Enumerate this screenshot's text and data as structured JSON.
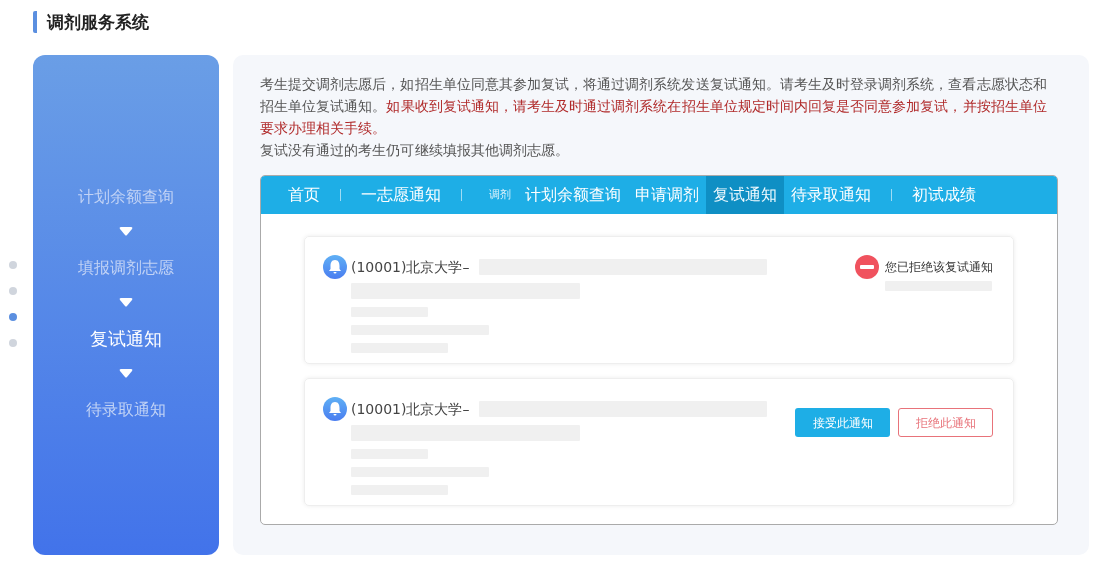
{
  "page_title": "调剂服务系统",
  "page_dots": [
    {
      "selected": false
    },
    {
      "selected": false
    },
    {
      "selected": true
    },
    {
      "selected": false
    }
  ],
  "steps": [
    {
      "label": "计划余额查询",
      "selected": false
    },
    {
      "label": "填报调剂志愿",
      "selected": false
    },
    {
      "label": "复试通知",
      "selected": true
    },
    {
      "label": "待录取通知",
      "selected": false
    }
  ],
  "intro": [
    {
      "segments": [
        {
          "text": "考生提交调剂志愿后，如招生单位同意其参加复试，将通过调剂系统发送复试通知。请考生及时登录调剂系统，查看志愿状态和招生单位复试通知。",
          "emphasis": false
        },
        {
          "text": "如果收到复试通知，请考生及时通过调剂系统在招生单位规定时间内回复是否同意参加复试，并按招生单位要求办理相关手续。",
          "emphasis": true
        }
      ]
    },
    {
      "segments": [
        {
          "text": "复试没有通过的考生仍可继续填报其他调剂志愿。",
          "emphasis": false
        }
      ]
    }
  ],
  "nav": [
    {
      "label": "首页",
      "kind": "tab",
      "selected": false,
      "divider_after": true
    },
    {
      "label": "一志愿通知",
      "kind": "tab",
      "selected": false,
      "divider_after": true
    },
    {
      "label": "调剂",
      "kind": "small",
      "divider_after": false
    },
    {
      "label": "计划余额查询",
      "kind": "tab",
      "selected": false,
      "divider_after": false
    },
    {
      "label": "申请调剂",
      "kind": "tab",
      "selected": false,
      "divider_after": false
    },
    {
      "label": "复试通知",
      "kind": "tab",
      "selected": true,
      "divider_after": false
    },
    {
      "label": "待录取通知",
      "kind": "tab",
      "selected": false,
      "divider_after": true
    },
    {
      "label": "初试成绩",
      "kind": "tab",
      "selected": false,
      "divider_after": false
    }
  ],
  "notices": [
    {
      "school": "(10001)北京大学–",
      "kind": "status",
      "status": "您已拒绝该复试通知"
    },
    {
      "school": "(10001)北京大学–",
      "kind": "actions",
      "buttons": [
        {
          "label": "接受此通知",
          "kind": "accept"
        },
        {
          "label": "拒绝此通知",
          "kind": "reject"
        }
      ]
    }
  ]
}
